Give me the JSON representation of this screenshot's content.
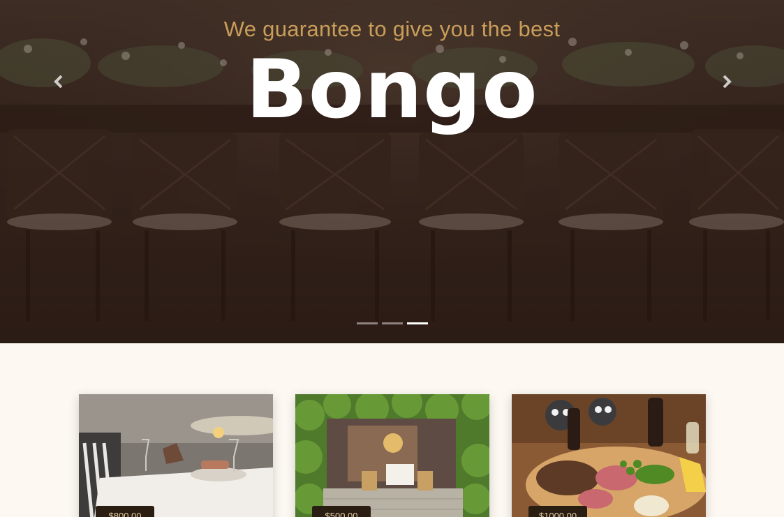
{
  "hero": {
    "subtitle": "We guarantee to give you the best",
    "title": "Bongo",
    "prev_icon": "chevron-left-icon",
    "next_icon": "chevron-right-icon",
    "indicators": [
      {
        "active": false
      },
      {
        "active": false
      },
      {
        "active": true
      }
    ],
    "colors": {
      "subtitle": "#c99d5a",
      "title": "#ffffff"
    }
  },
  "cards": [
    {
      "price": "$800.00"
    },
    {
      "price": "$500.00"
    },
    {
      "price": "$1000.00"
    }
  ],
  "colors": {
    "page_background": "#fdf8f2",
    "badge_background": "#2a1d12",
    "badge_text": "#e7cfa6"
  }
}
